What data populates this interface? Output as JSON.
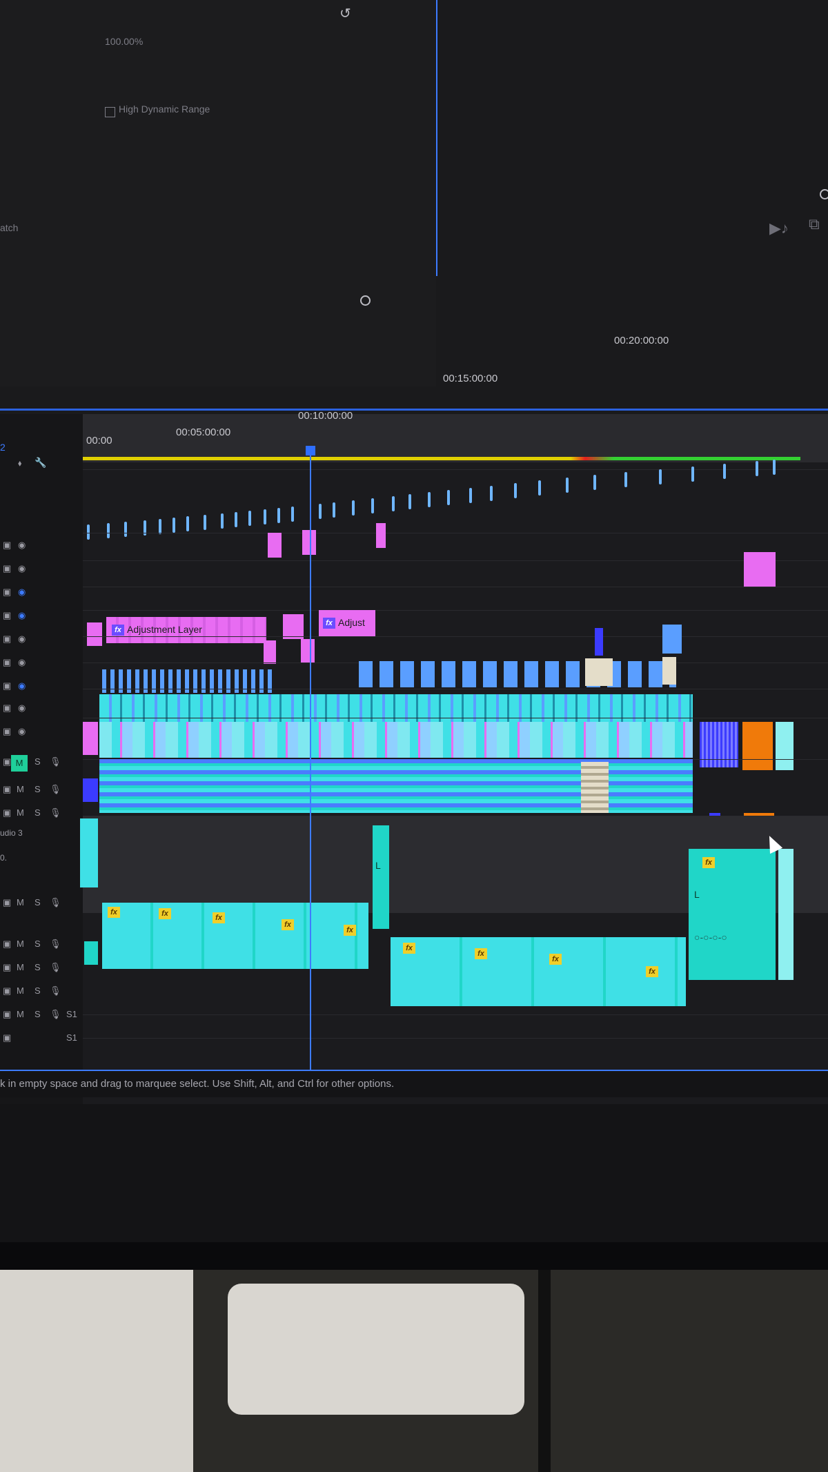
{
  "program_monitor": {
    "zoom": "100.00%",
    "hdr_label": "High Dynamic Range",
    "left_partial": "atch"
  },
  "timeline": {
    "timecodes": [
      "00:00",
      "00:05:00:00",
      "00:10:00:00",
      "00:15:00:00",
      "00:20:00:00"
    ],
    "clip_labels": {
      "adjustment_layer": "Adjustment Layer",
      "adjust": "Adjust"
    },
    "fx_label": "fx",
    "l_label": "L",
    "colors": {
      "video_cyan": "#3fe0e6",
      "video_blue": "#5a9eff",
      "adjustment_pink": "#e86cf2",
      "audio_teal": "#20d6c8",
      "orange": "#f07a0a",
      "beige": "#e4ddc9",
      "playhead": "#2f6fff"
    }
  },
  "track_headers": {
    "partial_track_num": "2",
    "audio_label": "udio 3",
    "mute": "M",
    "solo": "S",
    "audio_ch_label": "S1",
    "zero_label": "0."
  },
  "status_bar": {
    "text": "k in empty space and drag to marquee select. Use Shift, Alt, and Ctrl for other options."
  }
}
